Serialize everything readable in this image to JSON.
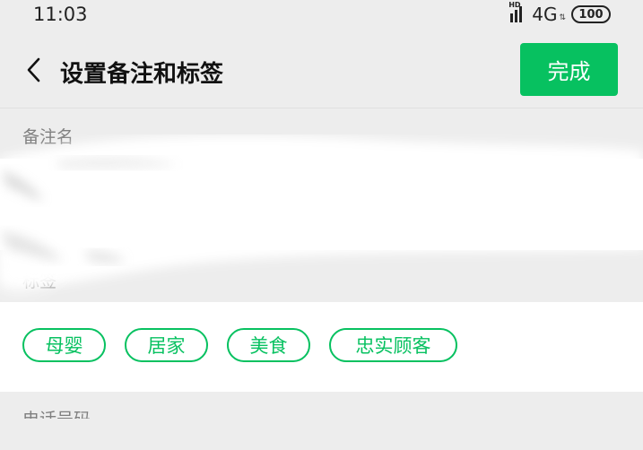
{
  "status_bar": {
    "time": "11:03",
    "hd_label": "HD",
    "network_label": "4G",
    "battery_level": "100"
  },
  "nav": {
    "title": "设置备注和标签",
    "done_label": "完成",
    "accent_color": "#07c160"
  },
  "remark": {
    "section_label": "备注名",
    "value": ""
  },
  "tags": {
    "section_label": "标签",
    "items": [
      "母婴",
      "居家",
      "美食",
      "忠实顾客"
    ]
  },
  "phone": {
    "section_label": "电话号码"
  }
}
